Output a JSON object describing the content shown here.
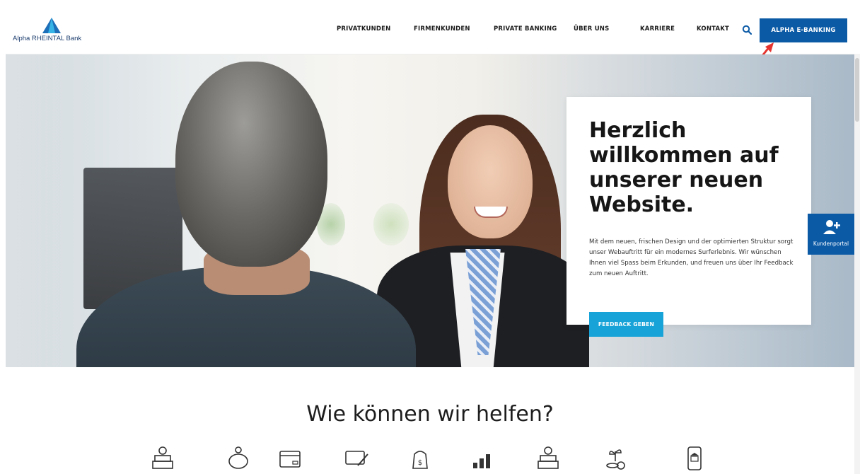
{
  "header": {
    "logo_text": "Alpha RHEINTAL Bank",
    "nav": [
      {
        "label": "PRIVATKUNDEN"
      },
      {
        "label": "FIRMENKUNDEN"
      },
      {
        "label": "PRIVATE BANKING"
      },
      {
        "label": "ÜBER UNS"
      },
      {
        "label": "KARRIERE"
      },
      {
        "label": "KONTAKT"
      }
    ],
    "search_icon": "search-icon",
    "ebanking_label": "ALPHA E-BANKING"
  },
  "hero": {
    "title": "Herzlich willkommen auf unserer neuen Website.",
    "text": "Mit dem neuen, frischen Design und der optimierten Struktur sorgt unser Webauftritt für ein modernes Surferlebnis. Wir wünschen Ihnen viel Spass beim Erkunden, und freuen uns über Ihr Feedback zum neuen Auftritt.",
    "button_label": "FEEDBACK GEBEN"
  },
  "side_portal": {
    "label": "Kundenportal",
    "icon": "add-user-icon"
  },
  "help": {
    "title": "Wie können wir helfen?",
    "icons": [
      "money-stack-icon",
      "piggy-bank-icon",
      "card-icon",
      "payment-icon",
      "money-bag-icon",
      "growth-chart-icon",
      "money-stack-icon",
      "plant-coins-icon",
      "mobile-bank-icon"
    ]
  },
  "colors": {
    "primary": "#0b5aa6",
    "accent": "#17a3d8",
    "annotation_arrow": "#e5342f"
  }
}
